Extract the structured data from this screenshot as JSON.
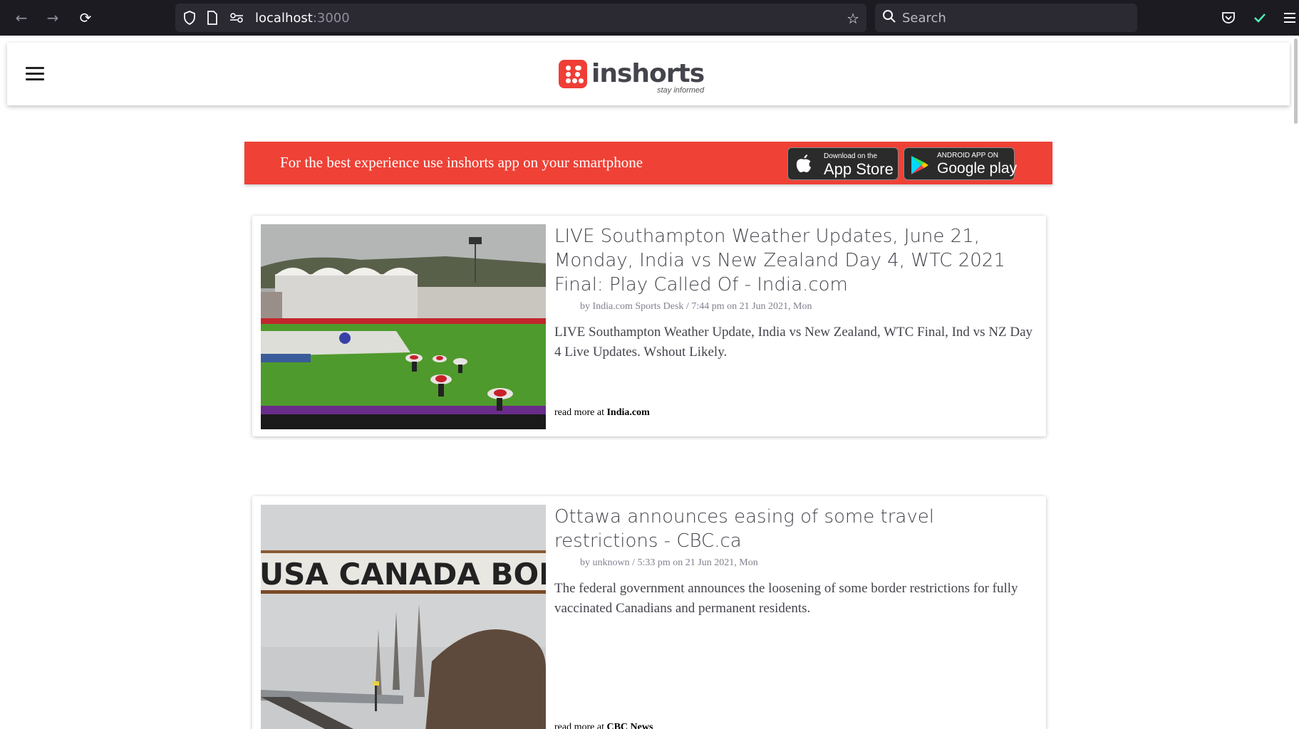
{
  "browser": {
    "url_host": "localhost",
    "url_port": ":3000",
    "search_placeholder": "Search"
  },
  "header": {
    "logo_text": "inshorts",
    "logo_tagline": "stay informed"
  },
  "banner": {
    "text": "For the best experience use inshorts app on your smartphone",
    "app_store_small": "Download on the",
    "app_store_big": "App Store",
    "google_play_small": "ANDROID APP ON",
    "google_play_big": "Google play"
  },
  "articles": [
    {
      "title": "LIVE Southampton Weather Updates, June 21, Monday, India vs New Zealand Day 4, WTC 2021 Final: Play Called Of - India.com",
      "by_prefix": "by ",
      "author": "India.com Sports Desk",
      "time": " / 7:44 pm on 21 Jun 2021, Mon",
      "summary": "LIVE Southampton Weather Update, India vs New Zealand, WTC Final, Ind vs NZ Day 4 Live Updates. Wshout Likely.",
      "read_more_prefix": "read more at ",
      "source": "India.com"
    },
    {
      "title": "Ottawa announces easing of some travel restrictions - CBC.ca",
      "by_prefix": "by ",
      "author": "unknown",
      "time": " / 5:33 pm on 21 Jun 2021, Mon",
      "summary": "The federal government announces the loosening of some border restrictions for fully vaccinated Canadians and permanent residents.",
      "read_more_prefix": "read more at ",
      "source": "CBC News",
      "image_sign_text": "USA CANADA BORDER"
    }
  ],
  "colors": {
    "brand_red": "#ef4136",
    "chrome_bg": "#1c1b22",
    "text": "#44444d"
  },
  "icons": [
    "back-arrow-icon",
    "forward-arrow-icon",
    "reload-icon",
    "shield-icon",
    "page-icon",
    "permissions-icon",
    "bookmark-star-icon",
    "search-icon",
    "pocket-icon",
    "checkmark-icon",
    "menu-icon",
    "apple-icon",
    "google-play-icon"
  ]
}
